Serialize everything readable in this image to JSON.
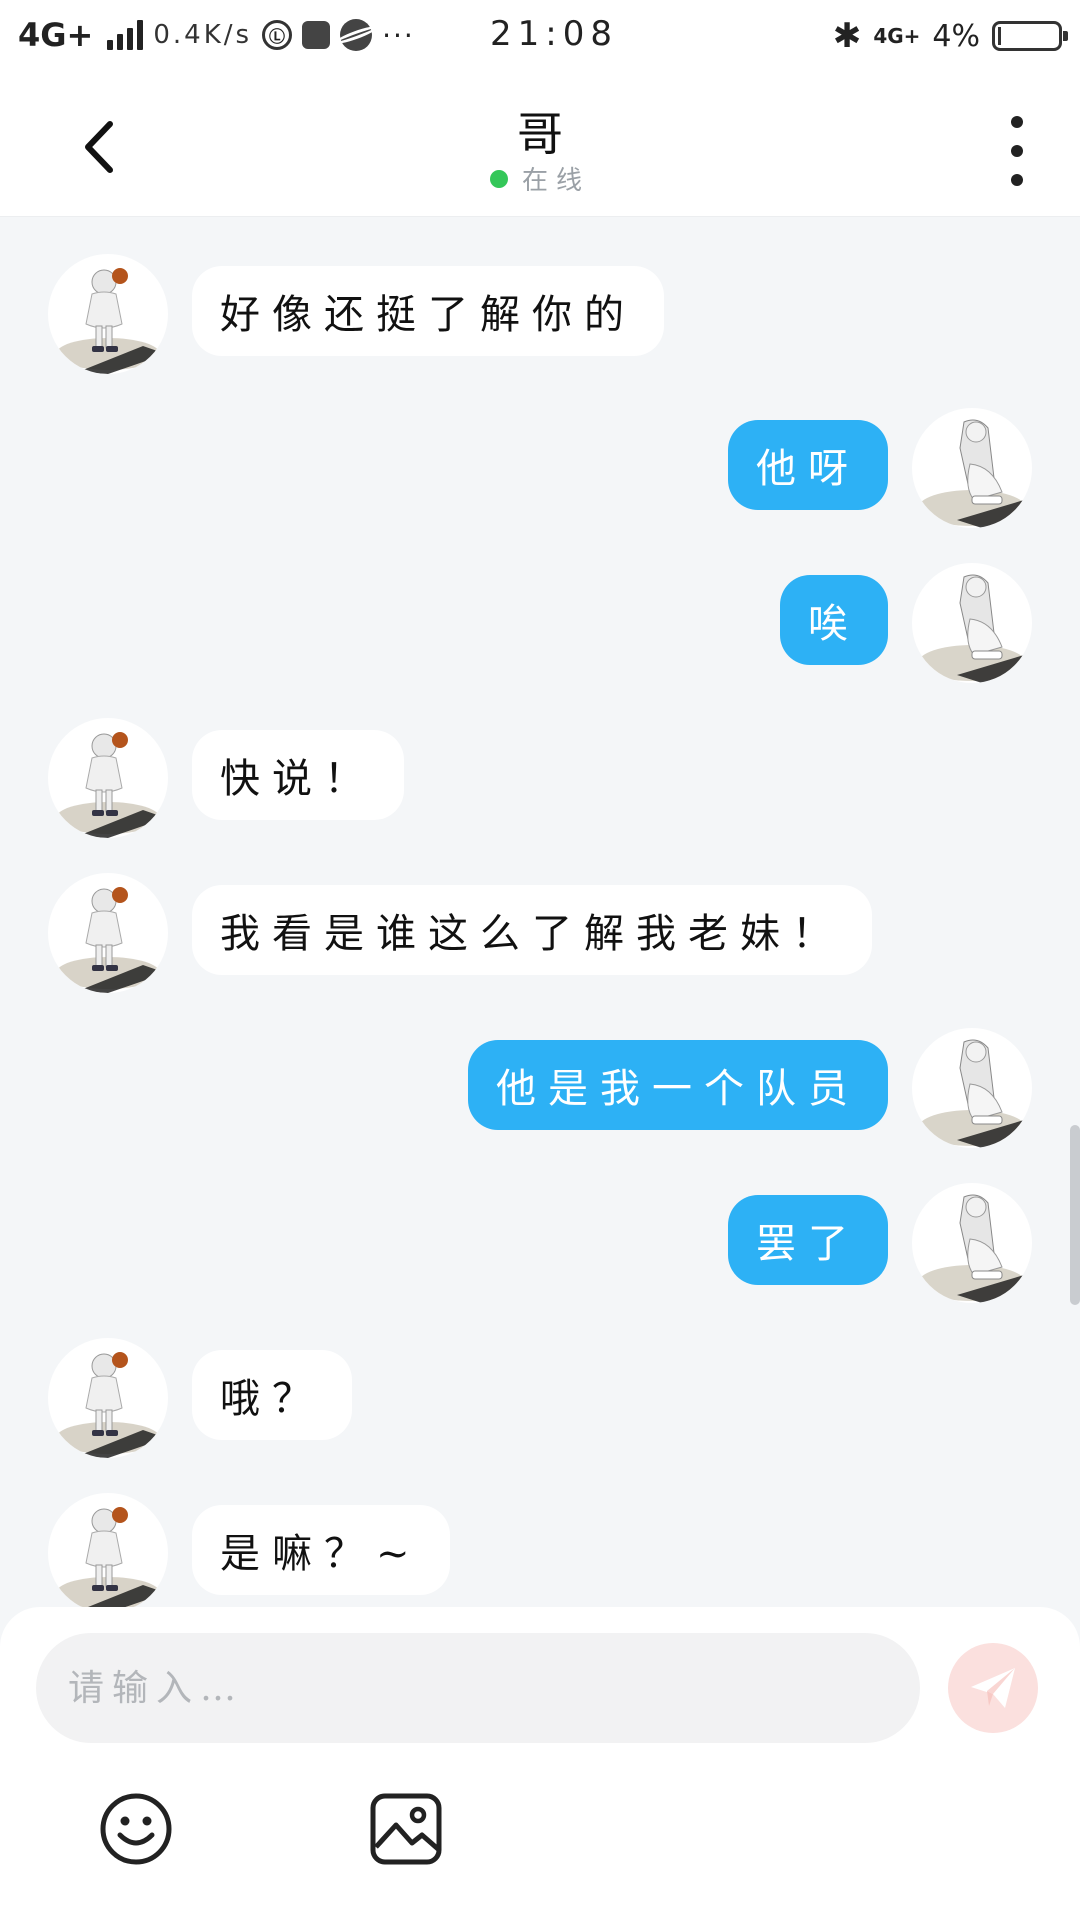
{
  "status_bar": {
    "network": "4G+",
    "speed": "0.4K/s",
    "time": "21:08",
    "network_right": "4G+",
    "battery": "4%"
  },
  "header": {
    "title": "哥",
    "status": "在线"
  },
  "messages": [
    {
      "side": "left",
      "text": "好像还挺了解你的"
    },
    {
      "side": "right",
      "text": "他呀"
    },
    {
      "side": "right",
      "text": "唉"
    },
    {
      "side": "left",
      "text": "快说！"
    },
    {
      "side": "left",
      "text": "我看是谁这么了解我老妹！"
    },
    {
      "side": "right",
      "text": "他是我一个队员"
    },
    {
      "side": "right",
      "text": "罢了"
    },
    {
      "side": "left",
      "text": "哦？"
    },
    {
      "side": "left",
      "text": "是嘛？~"
    }
  ],
  "input": {
    "placeholder": "请输入…"
  },
  "colors": {
    "accent_bubble": "#2db1f5",
    "online": "#34c759",
    "send_button": "#fbe0de",
    "background": "#f4f6f8"
  },
  "icons": {
    "back": "chevron-left-icon",
    "more": "more-vertical-icon",
    "send": "paper-plane-icon",
    "emoji": "smiley-icon",
    "image": "image-icon"
  }
}
